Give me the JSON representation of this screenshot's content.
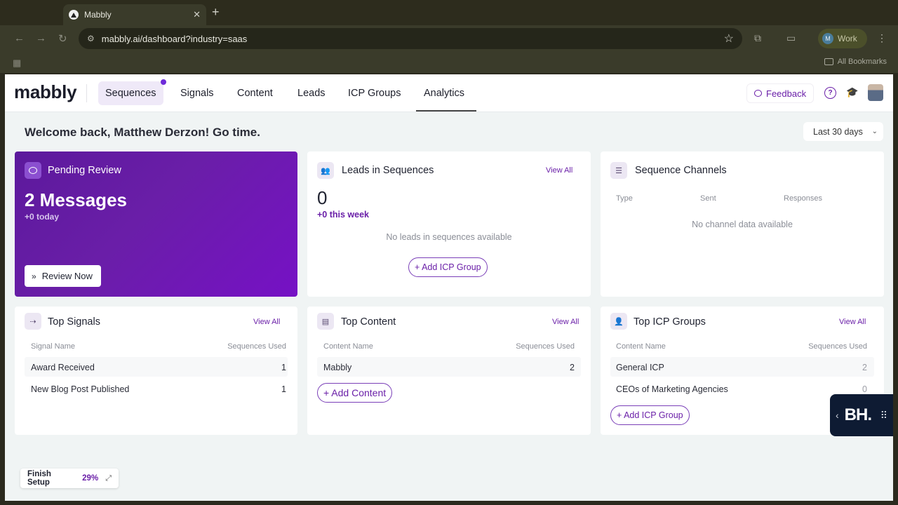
{
  "browser": {
    "tab_title": "Mabbly",
    "url": "mabbly.ai/dashboard?industry=saas",
    "profile_initial": "M",
    "profile_label": "Work",
    "bookmarks_label": "All Bookmarks"
  },
  "nav": {
    "logo": "mabbly",
    "items": [
      "Sequences",
      "Signals",
      "Content",
      "Leads",
      "ICP Groups",
      "Analytics"
    ],
    "feedback": "Feedback"
  },
  "header": {
    "welcome": "Welcome back, Matthew Derzon! Go time.",
    "date_range": "Last 30 days"
  },
  "pending": {
    "title": "Pending Review",
    "count": "2 Messages",
    "sub": "+0 today",
    "button": "Review Now"
  },
  "leads": {
    "title": "Leads in Sequences",
    "view_all": "View All",
    "count": "0",
    "sub": "+0 this week",
    "empty": "No leads in sequences available",
    "button": "+ Add ICP Group"
  },
  "channels": {
    "title": "Sequence Channels",
    "columns": [
      "Type",
      "Sent",
      "Responses"
    ],
    "empty": "No channel data available"
  },
  "signals": {
    "title": "Top Signals",
    "view_all": "View All",
    "columns": [
      "Signal Name",
      "Sequences Used"
    ],
    "rows": [
      {
        "name": "Award Received",
        "value": "1"
      },
      {
        "name": "New Blog Post Published",
        "value": "1"
      }
    ]
  },
  "content": {
    "title": "Top Content",
    "view_all": "View All",
    "columns": [
      "Content Name",
      "Sequences Used"
    ],
    "rows": [
      {
        "name": "Mabbly",
        "value": "2"
      }
    ],
    "button": "+ Add Content"
  },
  "icp": {
    "title": "Top ICP Groups",
    "view_all": "View All",
    "columns": [
      "Content Name",
      "Sequences Used"
    ],
    "rows": [
      {
        "name": "General ICP",
        "value": "2"
      },
      {
        "name": "CEOs of Marketing Agencies",
        "value": "0"
      }
    ],
    "button": "+ Add ICP Group"
  },
  "finish": {
    "label": "Finish Setup",
    "percent": "29%"
  },
  "widget": {
    "mark": "BH."
  }
}
